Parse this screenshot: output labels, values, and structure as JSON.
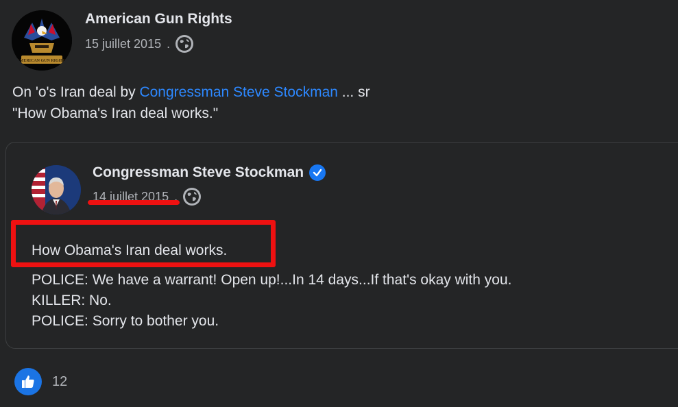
{
  "post": {
    "author": "American Gun Rights",
    "date": "15 juillet 2015",
    "separator": ".",
    "text_line1_prefix": "On 'o's Iran deal by ",
    "text_line1_link": "Congressman Steve Stockman",
    "text_line1_suffix": " ... sr",
    "text_line2": "\"How Obama's Iran deal works.\"",
    "avatar_text": "AMERICAN GUN RIGHTS"
  },
  "shared": {
    "author": "Congressman Steve Stockman",
    "date": "14 juillet 2015",
    "separator": ".",
    "headline": "How Obama's Iran deal works.",
    "lines": [
      "POLICE: We have a warrant! Open up!...In 14 days...If that's okay with you.",
      "KILLER: No.",
      "POLICE: Sorry to bother you."
    ]
  },
  "reactions": {
    "count": "12",
    "icon": "like-icon"
  },
  "icons": {
    "visibility": "globe-icon",
    "verified": "verified-badge-icon"
  },
  "colors": {
    "background": "#242526",
    "link": "#2d88ff",
    "annotation": "#ee1111",
    "like": "#1b74e4"
  }
}
